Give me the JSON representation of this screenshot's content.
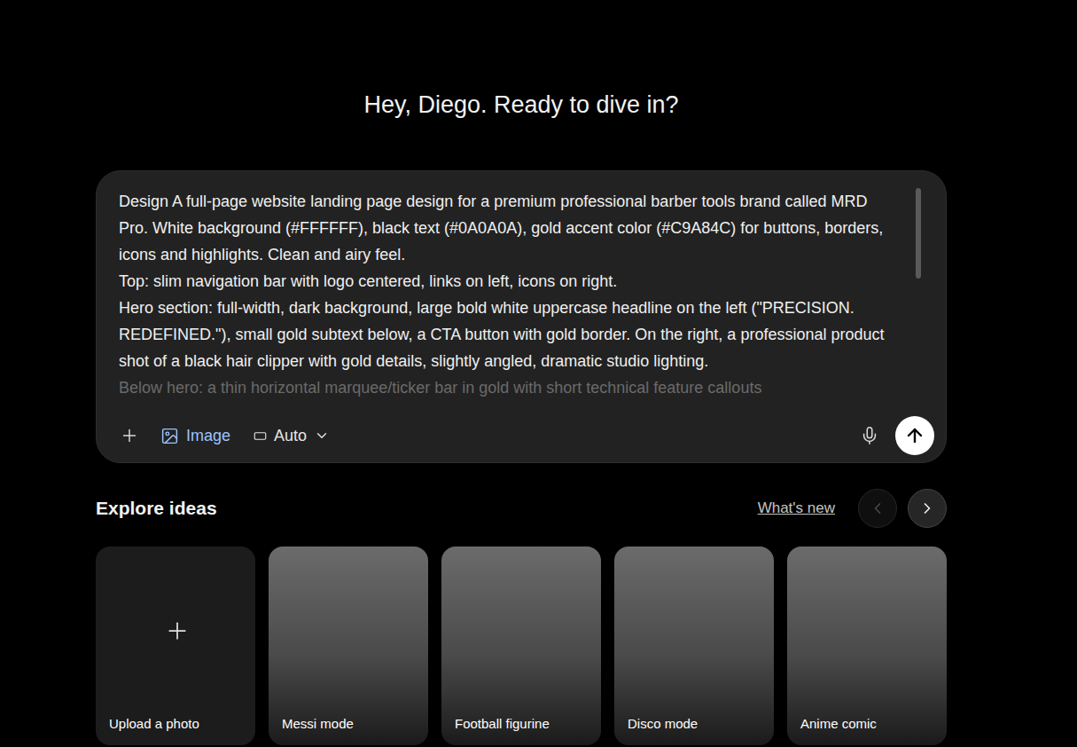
{
  "greeting": "Hey, Diego. Ready to dive in?",
  "prompt": {
    "paragraphs": [
      {
        "text": "Design A full-page website landing page design for a premium professional barber tools brand called MRD Pro. White background (#FFFFFF), black text (#0A0A0A), gold accent color (#C9A84C) for buttons, borders, icons and highlights. Clean and airy feel.",
        "faded": false
      },
      {
        "text": "Top: slim navigation bar with logo centered, links on left, icons on right.",
        "faded": false
      },
      {
        "text": "Hero section: full-width, dark background, large bold white uppercase headline on the left (\"PRECISION. REDEFINED.\"), small gold subtext below, a CTA button with gold border. On the right, a professional product shot of a black hair clipper with gold details, slightly angled, dramatic studio lighting.",
        "faded": false
      },
      {
        "text": "Below hero: a thin horizontal marquee/ticker bar in gold with short technical feature callouts",
        "faded": true
      }
    ],
    "scrollbar": {
      "level": 0.4
    }
  },
  "toolbar": {
    "image": {
      "label": "Image",
      "selected": true
    },
    "mode": {
      "label": "Auto"
    }
  },
  "explore": {
    "title": "Explore ideas",
    "whats_new": "What's new",
    "prev_disabled": true,
    "next_disabled": false
  },
  "cards": [
    {
      "label": "Upload a photo",
      "kind": "upload"
    },
    {
      "label": "Messi mode",
      "kind": "photo"
    },
    {
      "label": "Football figurine",
      "kind": "photo"
    },
    {
      "label": "Disco mode",
      "kind": "photo"
    },
    {
      "label": "Anime comic",
      "kind": "photo"
    }
  ]
}
